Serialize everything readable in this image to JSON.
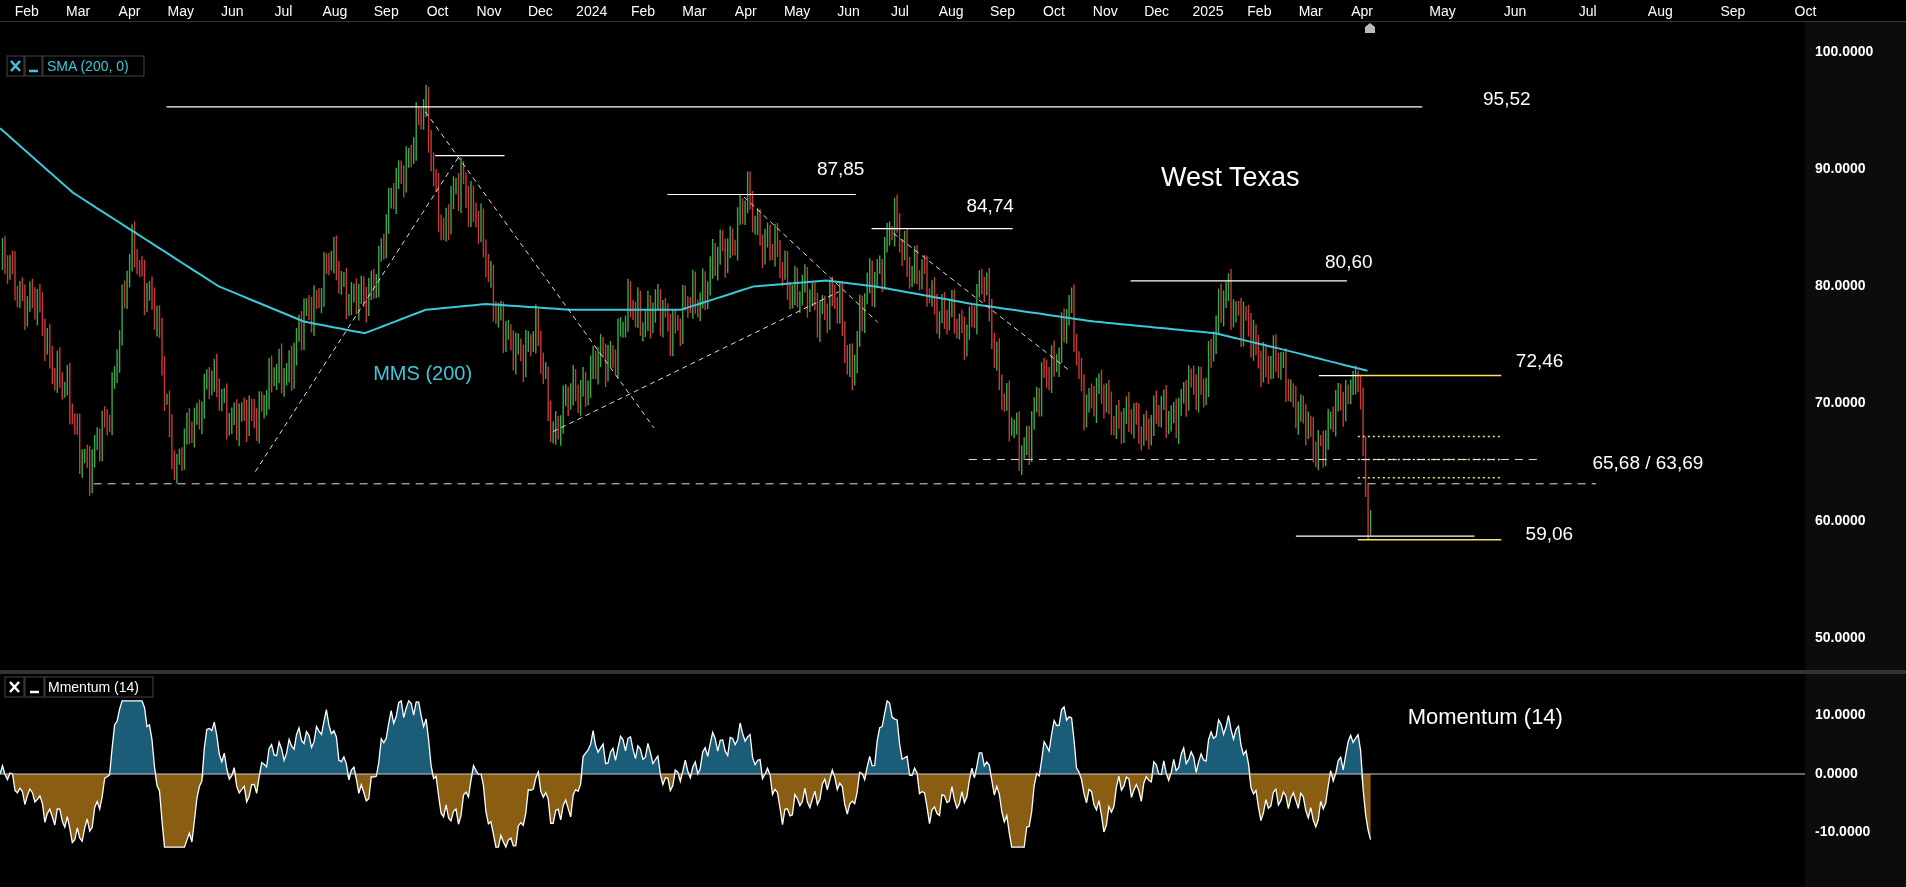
{
  "time_axis": {
    "labels": [
      "Feb",
      "Mar",
      "Apr",
      "May",
      "Jun",
      "Jul",
      "Aug",
      "Sep",
      "Oct",
      "Nov",
      "Dec",
      "2024",
      "Feb",
      "Mar",
      "Apr",
      "May",
      "Jun",
      "Jul",
      "Aug",
      "Sep",
      "Oct",
      "Nov",
      "Dec",
      "2025",
      "Feb",
      "Mar",
      "Apr",
      "May",
      "Jun",
      "Jul",
      "Aug",
      "Sep",
      "Oct"
    ]
  },
  "price_chart": {
    "legend": "SMA (200, 0)",
    "title": "West Texas",
    "sma_label": "MMS (200)",
    "price_levels": [
      {
        "label": "95,52"
      },
      {
        "label": "87,85"
      },
      {
        "label": "84,74"
      },
      {
        "label": "80,60"
      },
      {
        "label": "72,46"
      },
      {
        "label": "65,68 / 63,69"
      },
      {
        "label": "59,06"
      }
    ],
    "y_axis": [
      "100.0000",
      "90.0000",
      "80.0000",
      "70.0000",
      "60.0000",
      "50.0000"
    ]
  },
  "momentum_panel": {
    "legend": "Mmentum (14)",
    "title": "Momentum (14)",
    "y_axis": [
      "10.0000",
      "0.0000",
      "-10.0000"
    ]
  }
}
